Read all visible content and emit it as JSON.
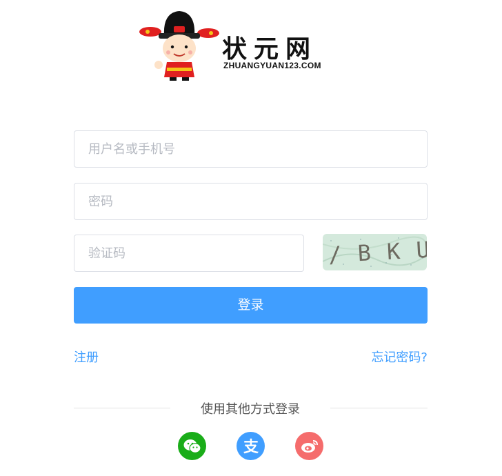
{
  "brand": {
    "name_cn": "状元网",
    "name_en": "ZHUANGYUAN123.COM"
  },
  "form": {
    "username_placeholder": "用户名或手机号",
    "password_placeholder": "密码",
    "captcha_placeholder": "验证码",
    "captcha_text": "/ B K U",
    "login_label": "登录"
  },
  "links": {
    "register": "注册",
    "forgot_password": "忘记密码?"
  },
  "social": {
    "heading": "使用其他方式登录",
    "items": [
      {
        "name": "wechat",
        "color": "#1aad19"
      },
      {
        "name": "alipay",
        "color": "#409eff"
      },
      {
        "name": "weibo",
        "color": "#f56c6c"
      }
    ]
  },
  "colors": {
    "accent": "#409eff",
    "input_border": "#dcdfe6",
    "placeholder": "#b6bac2"
  }
}
